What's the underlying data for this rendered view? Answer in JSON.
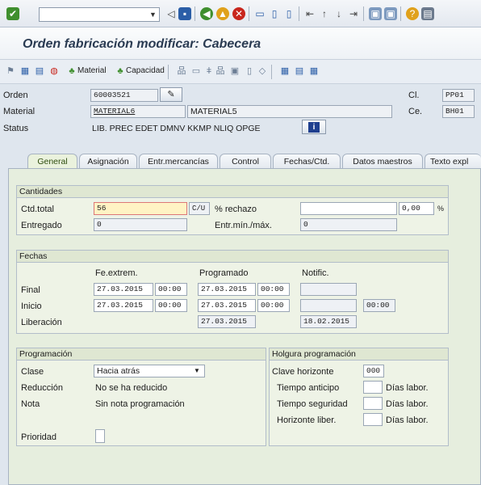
{
  "system_toolbar": {
    "icons": [
      "check-icon",
      "save-icon",
      "back-icon",
      "exit-icon",
      "cancel-icon",
      "print-icon",
      "find-icon",
      "find-next-icon",
      "first-page-icon",
      "prev-page-icon",
      "next-page-icon",
      "last-page-icon",
      "new-session-icon",
      "shortcut-icon",
      "help-icon",
      "layout-icon"
    ],
    "command_field": ""
  },
  "title": "Orden fabricación modificar: Cabecera",
  "app_toolbar": {
    "material_label": "Material",
    "capacidad_label": "Capacidad"
  },
  "header": {
    "orden_label": "Orden",
    "orden_value": "60003521",
    "material_label": "Material",
    "material_value": "MATERIAL6",
    "material_desc": "MATERIAL5",
    "status_label": "Status",
    "status_value": "LIB. PREC EDET DMNV KKMP NLIQ OPGE",
    "cl_label": "Cl.",
    "cl_value": "PP01",
    "ce_label": "Ce.",
    "ce_value": "BH01"
  },
  "tabs": [
    "General",
    "Asignación",
    "Entr.mercancías",
    "Control",
    "Fechas/Ctd.",
    "Datos maestros",
    "Texto expl"
  ],
  "cantidades": {
    "title": "Cantidades",
    "ctd_total_label": "Ctd.total",
    "ctd_total_value": "56",
    "unit": "C/U",
    "rechazo_label": "% rechazo",
    "rechazo_value": "0,00",
    "percent": "%",
    "entregado_label": "Entregado",
    "entregado_value": "0",
    "entr_label": "Entr.mín./máx.",
    "entr_value": "0"
  },
  "fechas": {
    "title": "Fechas",
    "col_extrem": "Fe.extrem.",
    "col_programado": "Programado",
    "col_notific": "Notific.",
    "final_label": "Final",
    "final_extrem_date": "27.03.2015",
    "final_extrem_time": "00:00",
    "final_prog_date": "27.03.2015",
    "final_prog_time": "00:00",
    "inicio_label": "Inicio",
    "inicio_extrem_date": "27.03.2015",
    "inicio_extrem_time": "00:00",
    "inicio_prog_date": "27.03.2015",
    "inicio_prog_time": "00:00",
    "inicio_notific_time": "00:00",
    "liberacion_label": "Liberación",
    "liberacion_prog_date": "27.03.2015",
    "liberacion_notific_date": "18.02.2015"
  },
  "programacion": {
    "title": "Programación",
    "clase_label": "Clase",
    "clase_value": "Hacia atrás",
    "reduccion_label": "Reducción",
    "reduccion_value": "No se ha reducido",
    "nota_label": "Nota",
    "nota_value": "Sin nota programación",
    "prioridad_label": "Prioridad"
  },
  "holgura": {
    "title": "Holgura programación",
    "clave_label": "Clave horizonte",
    "clave_value": "000",
    "anticipo_label": "Tiempo anticipo",
    "seguridad_label": "Tiempo seguridad",
    "horizonte_label": "Horizonte liber.",
    "dias_labor": "Días labor."
  },
  "colors": {
    "accent": "#2a3b52",
    "tab_active": "#eaf2dd",
    "highlight": "#fff3c4"
  }
}
